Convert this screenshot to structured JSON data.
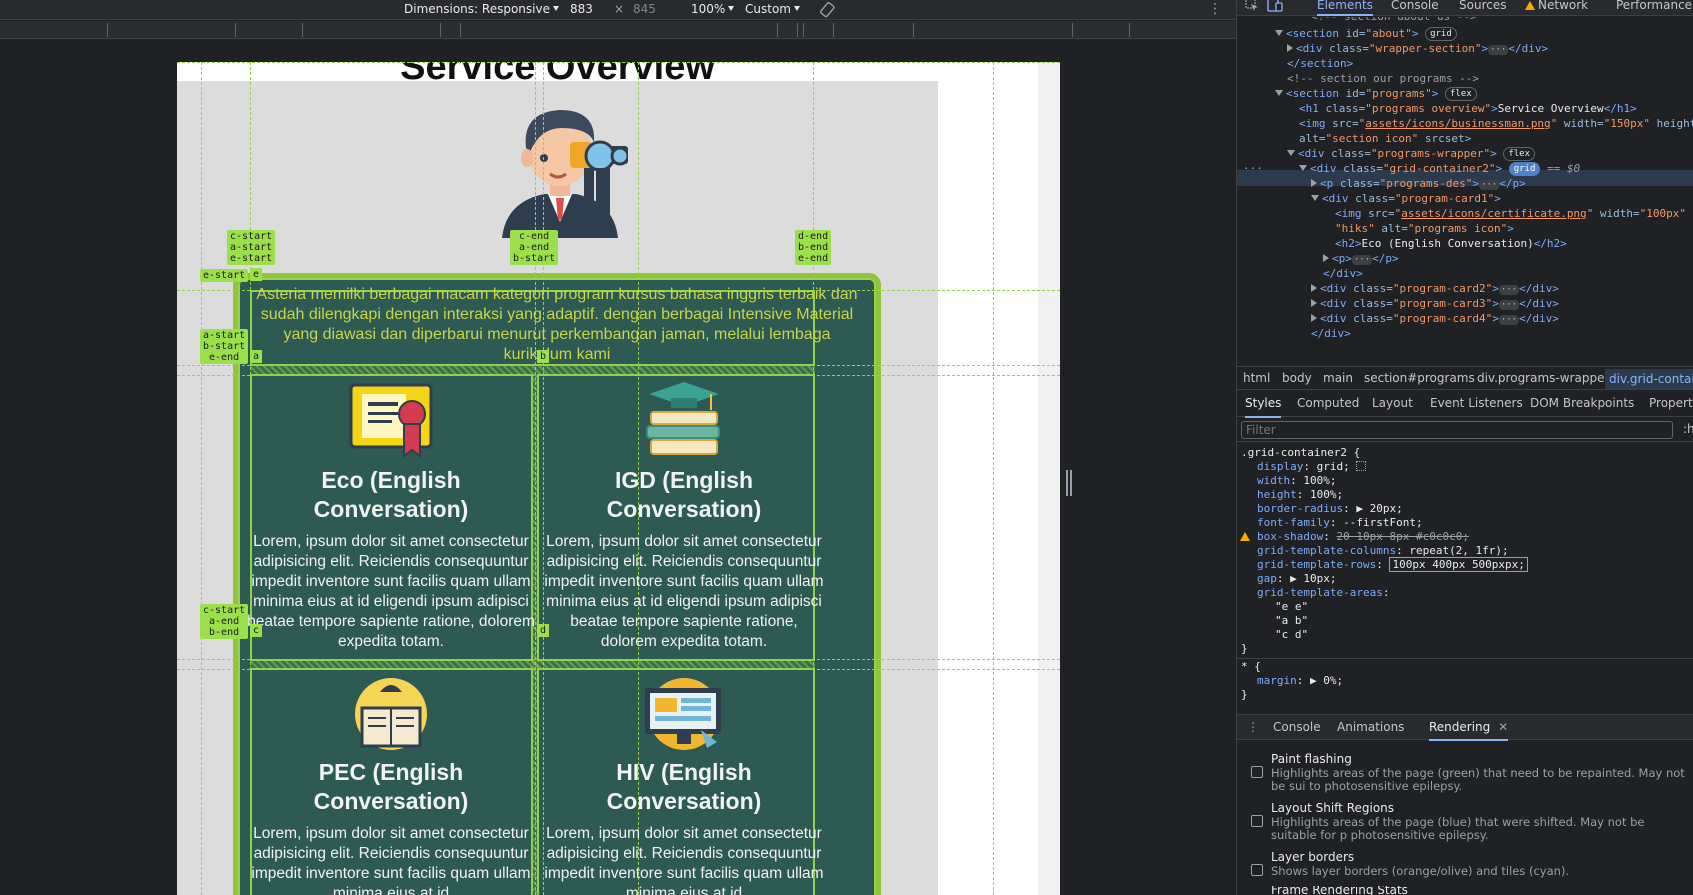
{
  "device_toolbar": {
    "dimensions_label": "Dimensions: Responsive",
    "width": "883",
    "times": "×",
    "height": "845",
    "zoom": "100%",
    "throttle": "Custom"
  },
  "page": {
    "title": "Service Overview",
    "description": "Asteria memilki berbagai macam kategori program kursus bahasa inggris terbaik dan sudah dilengkapi dengan interaksi yang adaptif. dengan berbagai Intensive Material yang diawasi dan diperbarui menurut perkembangan jaman, melalui lembaga kurikulum kami",
    "cards": [
      {
        "title": "Eco (English Conversation)",
        "text": "Lorem, ipsum dolor sit amet consectetur adipisicing elit. Reiciendis consequuntur impedit inventore sunt facilis quam ullam minima eius at id eligendi ipsum adipisci beatae tempore sapiente ratione, dolorem expedita totam.",
        "icon": "certificate-icon"
      },
      {
        "title": "IGD (English Conversation)",
        "text": "Lorem, ipsum dolor sit amet consectetur adipisicing elit. Reiciendis consequuntur impedit inventore sunt facilis quam ullam minima eius at id eligendi ipsum adipisci beatae tempore sapiente ratione, dolorem expedita totam.",
        "icon": "books-graduation-cap-icon"
      },
      {
        "title": "PEC (English Conversation)",
        "text": "Lorem, ipsum dolor sit amet consectetur adipisicing elit. Reiciendis consequuntur impedit inventore sunt facilis quam ullam minima eius at id",
        "icon": "reading-book-icon"
      },
      {
        "title": "HIV (English Conversation)",
        "text": "Lorem, ipsum dolor sit amet consectetur adipisicing elit. Reiciendis consequuntur impedit inventore sunt facilis quam ullam minima eius at id",
        "icon": "computer-monitor-icon"
      }
    ]
  },
  "grid_overlay": {
    "top_labels": [
      "c-start\na-start\ne-start",
      "c-end\na-end\nb-start",
      "d-end\nb-end\ne-end"
    ],
    "side_labels": [
      "e-start",
      "a-start\nb-start\ne-end",
      "c-start\na-end\nb-end"
    ],
    "area_labels": [
      "e",
      "a",
      "b",
      "c",
      "d"
    ]
  },
  "devtools": {
    "tabs": [
      "Elements",
      "Console",
      "Sources",
      "Network",
      "Performance"
    ],
    "elements": {
      "cut_comment": "<!-- section about us -->",
      "section_about": {
        "tag_open": "<section ",
        "attr": "id=",
        "val": "\"about\"",
        "close": ">",
        "pill": "grid"
      },
      "wrapper_section": {
        "open": "<div ",
        "attr": "class=",
        "val": "\"wrapper-section\"",
        "close": ">",
        "end": "</div>"
      },
      "section_close": "</section>",
      "programs_comment": "<!-- section our programs -->",
      "section_programs": {
        "tag_open": "<section ",
        "attr": "id=",
        "val": "\"programs\"",
        "close": ">",
        "pill": "flex"
      },
      "h1": {
        "open": "<h1 ",
        "attr": "class=",
        "val": "\"programs overview\"",
        "close": ">",
        "text": "Service Overview",
        "end": "</h1>"
      },
      "img": {
        "open": "<img ",
        "a1": "src=",
        "v1": "\"",
        "link": "assets/icons/businessman.png",
        "v1b": "\"",
        "a2": " width=",
        "v2": "\"150px\"",
        "a3": " height"
      },
      "img_alt": {
        "attr": "alt=",
        "val": "\"section icon\"",
        "attr2": " srcset",
        "close": ">"
      },
      "programs_wrapper": {
        "open": "<div ",
        "attr": "class=",
        "val": "\"programs-wrapper\"",
        "close": ">",
        "pill": "flex"
      },
      "grid_container": {
        "open": "<div ",
        "attr": "class=",
        "val": "\"grid-container2\"",
        "close": ">",
        "pill": "grid",
        "eq": "== $0"
      },
      "programs_des": {
        "open": "<p ",
        "attr": "class=",
        "val": "\"programs-des\"",
        "close": ">",
        "end": "</p>"
      },
      "program_card1": {
        "open": "<div ",
        "attr": "class=",
        "val": "\"program-card1\"",
        "close": ">"
      },
      "card_img": {
        "open": "<img ",
        "a1": "src=",
        "link": "assets/icons/certificate.png",
        "a2": " width=",
        "v2": "\"100px\""
      },
      "card_img_alt": {
        "val": "\"hiks\"",
        "attr": " alt=",
        "val2": "\"programs icon\"",
        "close": ">"
      },
      "h2": {
        "open": "<h2>",
        "text": "Eco (English Conversation)",
        "end": "</h2>"
      },
      "p_line": {
        "open": "<p>",
        "end": "</p>"
      },
      "div_close": "</div>",
      "card2": {
        "open": "<div ",
        "attr": "class=",
        "val": "\"program-card2\"",
        "close": ">",
        "end": "</div>"
      },
      "card3": {
        "open": "<div ",
        "attr": "class=",
        "val": "\"program-card3\"",
        "close": ">",
        "end": "</div>"
      },
      "card4": {
        "open": "<div ",
        "attr": "class=",
        "val": "\"program-card4\"",
        "close": ">",
        "end": "</div>"
      },
      "final_close": "</div>",
      "ellipsis": "…",
      "more": "···"
    },
    "breadcrumbs": [
      "html",
      "body",
      "main",
      "section#programs",
      "div.programs-wrapper",
      "div.grid-contain"
    ],
    "style_tabs": [
      "Styles",
      "Computed",
      "Layout",
      "Event Listeners",
      "DOM Breakpoints",
      "Propert"
    ],
    "filter_placeholder": "Filter",
    "filter_suffix": ":h",
    "rule": {
      "selector": ".grid-container2 {",
      "props": [
        {
          "name": "display",
          "value": "grid;"
        },
        {
          "name": "width",
          "value": "100%;"
        },
        {
          "name": "height",
          "value": "100%;"
        },
        {
          "name": "border-radius",
          "value": "▶ 20px;"
        },
        {
          "name": "font-family",
          "value": "--firstFont;"
        },
        {
          "name": "box-shadow",
          "value": "20 10px 8px #c0c0c0;"
        },
        {
          "name": "grid-template-columns",
          "value": "repeat(2, 1fr);"
        },
        {
          "name": "grid-template-rows",
          "value": "100px 400px 500pxpx;"
        },
        {
          "name": "gap",
          "value": "▶ 10px;"
        },
        {
          "name": "grid-template-areas",
          "value": ""
        }
      ],
      "areas": [
        "\"e e\"",
        "\"a b\"",
        "\"c d\""
      ],
      "close": "}"
    },
    "rule2": {
      "selector": "* {",
      "prop": "margin",
      "value": "▶ 0%;",
      "close": "}"
    },
    "drawer_tabs": [
      "Console",
      "Animations",
      "Rendering"
    ],
    "close_x": "✕",
    "kebab": "⋮",
    "rendering": [
      {
        "title": "Paint flashing",
        "desc": "Highlights areas of the page (green) that need to be repainted. May not be sui to photosensitive epilepsy."
      },
      {
        "title": "Layout Shift Regions",
        "desc": "Highlights areas of the page (blue) that were shifted. May not be suitable for p photosensitive epilepsy."
      },
      {
        "title": "Layer borders",
        "desc": "Shows layer borders (orange/olive) and tiles (cyan)."
      },
      {
        "title": "Frame Rendering Stats",
        "desc": ""
      }
    ]
  }
}
